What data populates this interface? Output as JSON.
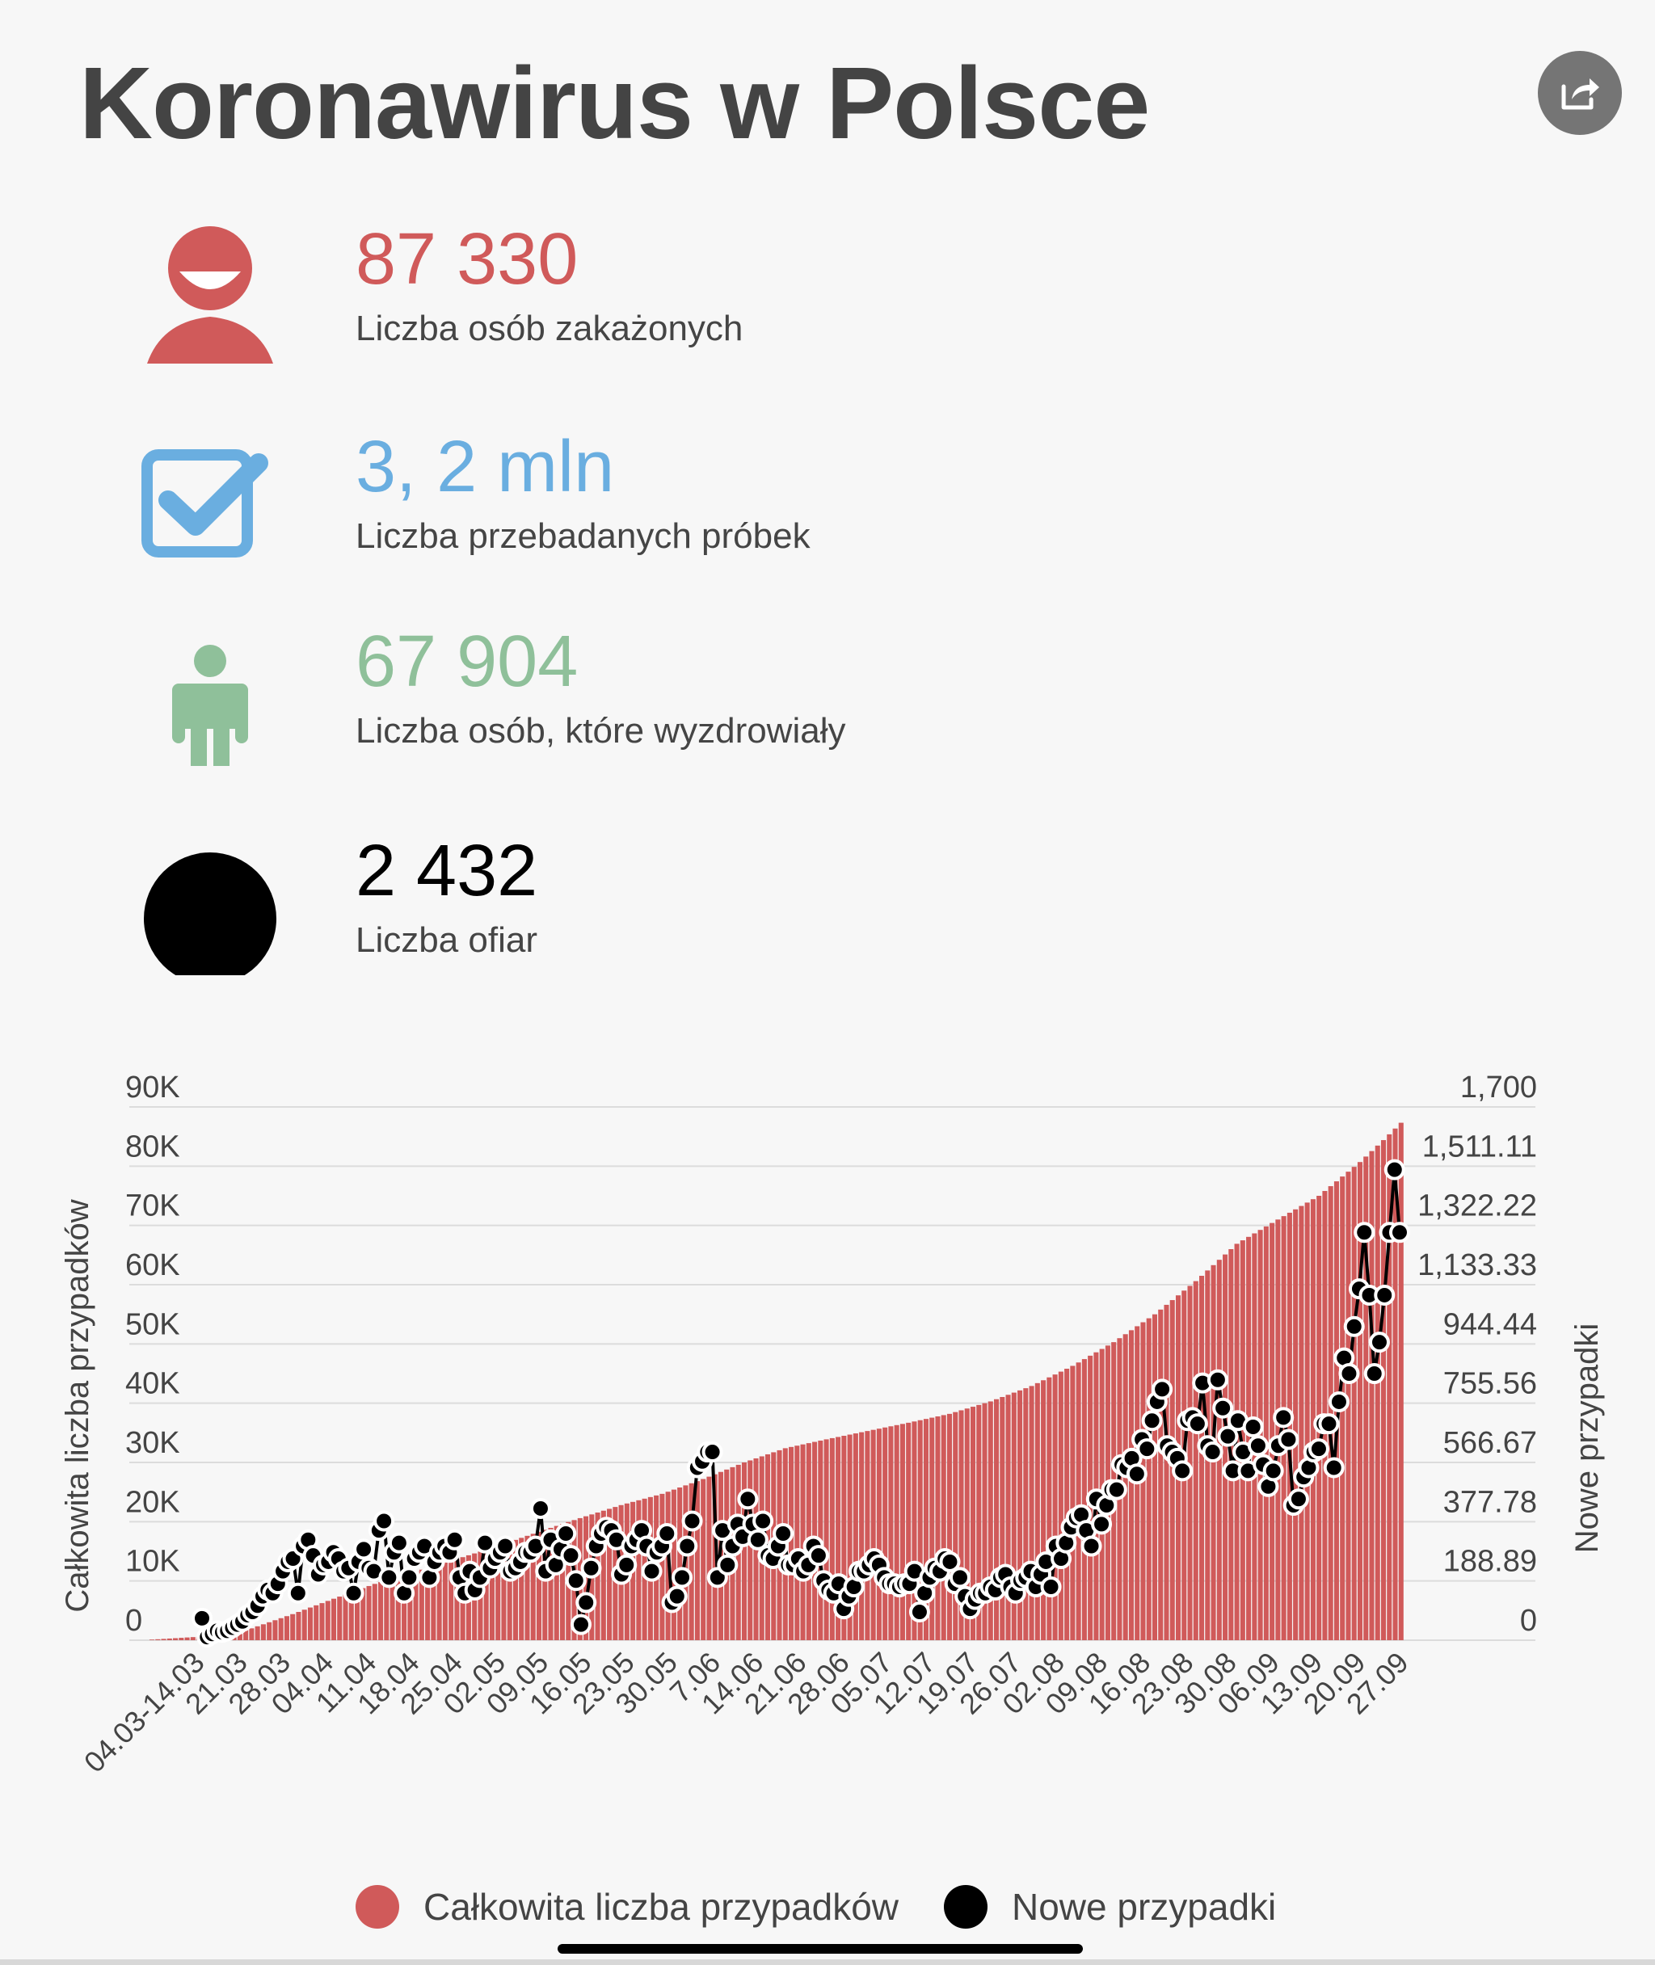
{
  "title": "Koronawirus w Polsce",
  "share_icon": "share-icon",
  "stats": [
    {
      "icon": "person-icon",
      "value": "87 330",
      "label": "Liczba osób zakażonych",
      "color": "#d05a5a"
    },
    {
      "icon": "checkbox-icon",
      "value": "3, 2 mln",
      "label": "Liczba przebadanych próbek",
      "color": "#6aaee0"
    },
    {
      "icon": "standing-person-icon",
      "value": "67 904",
      "label": "Liczba osób, które wyzdrowiały",
      "color": "#8fc09a"
    },
    {
      "icon": "black-circle-icon",
      "value": "2 432",
      "label": "Liczba ofiar",
      "color": "#000000"
    }
  ],
  "chart_data": {
    "type": "bar+line",
    "left_axis": {
      "label": "Całkowita liczba przypadków",
      "ticks": [
        "0",
        "10K",
        "20K",
        "30K",
        "40K",
        "50K",
        "60K",
        "70K",
        "80K",
        "90K"
      ],
      "range": [
        0,
        90000
      ]
    },
    "right_axis": {
      "label": "Nowe przypadki",
      "ticks": [
        "0",
        "188.89",
        "377.78",
        "566.67",
        "755.56",
        "944.44",
        "1,133.33",
        "1,322.22",
        "1,511.11",
        "1,700"
      ],
      "range": [
        0,
        1700
      ]
    },
    "x_tick_labels": [
      "04.03-14.03",
      "21.03",
      "28.03",
      "04.04",
      "11.04",
      "18.04",
      "25.04",
      "02.05",
      "09.05",
      "16.05",
      "23.05",
      "30.05",
      "7.06",
      "14.06",
      "21.06",
      "28.06",
      "05.07",
      "12.07",
      "19.07",
      "26.07",
      "02.08",
      "09.08",
      "16.08",
      "23.08",
      "30.08",
      "06.09",
      "13.09",
      "20.09",
      "27.09"
    ],
    "grid": true,
    "legend_position": "bottom",
    "series": [
      {
        "name": "Całkowita liczba przypadków",
        "type": "bar",
        "axis": "left",
        "color": "#d05a5a",
        "key_values": [
          [
            0,
            100
          ],
          [
            10,
            700
          ],
          [
            17,
            2000
          ],
          [
            24,
            4400
          ],
          [
            31,
            7000
          ],
          [
            38,
            9500
          ],
          [
            45,
            11600
          ],
          [
            52,
            13700
          ],
          [
            59,
            15900
          ],
          [
            66,
            18300
          ],
          [
            73,
            20600
          ],
          [
            80,
            22800
          ],
          [
            87,
            24700
          ],
          [
            94,
            27200
          ],
          [
            101,
            30000
          ],
          [
            108,
            32400
          ],
          [
            115,
            33900
          ],
          [
            122,
            35300
          ],
          [
            129,
            36700
          ],
          [
            136,
            38200
          ],
          [
            143,
            40300
          ],
          [
            150,
            42900
          ],
          [
            157,
            46300
          ],
          [
            164,
            50300
          ],
          [
            171,
            55000
          ],
          [
            178,
            60600
          ],
          [
            185,
            66900
          ],
          [
            192,
            71000
          ],
          [
            199,
            75000
          ],
          [
            206,
            80700
          ],
          [
            210,
            84400
          ],
          [
            213,
            87330
          ]
        ]
      },
      {
        "name": "Nowe przypadki",
        "type": "line",
        "axis": "right",
        "color": "#000000",
        "values": [
          70,
          10,
          20,
          30,
          25,
          30,
          40,
          50,
          60,
          80,
          90,
          110,
          140,
          160,
          150,
          180,
          220,
          250,
          260,
          150,
          300,
          320,
          270,
          210,
          240,
          250,
          280,
          260,
          220,
          230,
          150,
          250,
          290,
          230,
          220,
          350,
          380,
          200,
          280,
          310,
          150,
          200,
          260,
          280,
          300,
          200,
          250,
          280,
          300,
          280,
          320,
          200,
          150,
          220,
          160,
          200,
          310,
          230,
          260,
          280,
          300,
          220,
          230,
          250,
          280,
          280,
          300,
          420,
          220,
          320,
          240,
          290,
          340,
          270,
          190,
          50,
          120,
          230,
          300,
          340,
          360,
          350,
          320,
          210,
          240,
          300,
          320,
          350,
          300,
          220,
          280,
          300,
          340,
          120,
          140,
          200,
          300,
          380,
          550,
          570,
          600,
          600,
          200,
          350,
          240,
          300,
          370,
          330,
          450,
          370,
          320,
          380,
          270,
          260,
          300,
          340,
          240,
          240,
          260,
          220,
          240,
          300,
          270,
          190,
          160,
          150,
          180,
          100,
          140,
          170,
          220,
          220,
          240,
          260,
          240,
          200,
          180,
          180,
          170,
          180,
          180,
          220,
          90,
          150,
          200,
          230,
          220,
          260,
          250,
          180,
          200,
          140,
          100,
          130,
          150,
          150,
          170,
          160,
          200,
          210,
          170,
          150,
          190,
          200,
          220,
          170,
          210,
          250,
          170,
          300,
          260,
          310,
          360,
          390,
          400,
          350,
          300,
          450,
          370,
          430,
          480,
          480,
          560,
          550,
          580,
          530,
          640,
          610,
          700,
          760,
          800,
          620,
          600,
          580,
          540,
          700,
          710,
          690,
          820,
          620,
          600,
          830,
          740,
          650,
          540,
          700,
          600,
          540,
          680,
          620,
          560,
          490,
          540,
          620,
          710,
          640,
          430,
          450,
          520,
          550,
          600,
          610,
          690,
          690,
          550,
          760,
          900,
          850,
          1000,
          1120,
          1300,
          1100,
          850,
          950,
          1100,
          1300,
          1500,
          1300
        ]
      }
    ]
  },
  "legend": [
    {
      "label": "Całkowita liczba przypadków",
      "color": "#d05a5a"
    },
    {
      "label": "Nowe przypadki",
      "color": "#000000"
    }
  ]
}
